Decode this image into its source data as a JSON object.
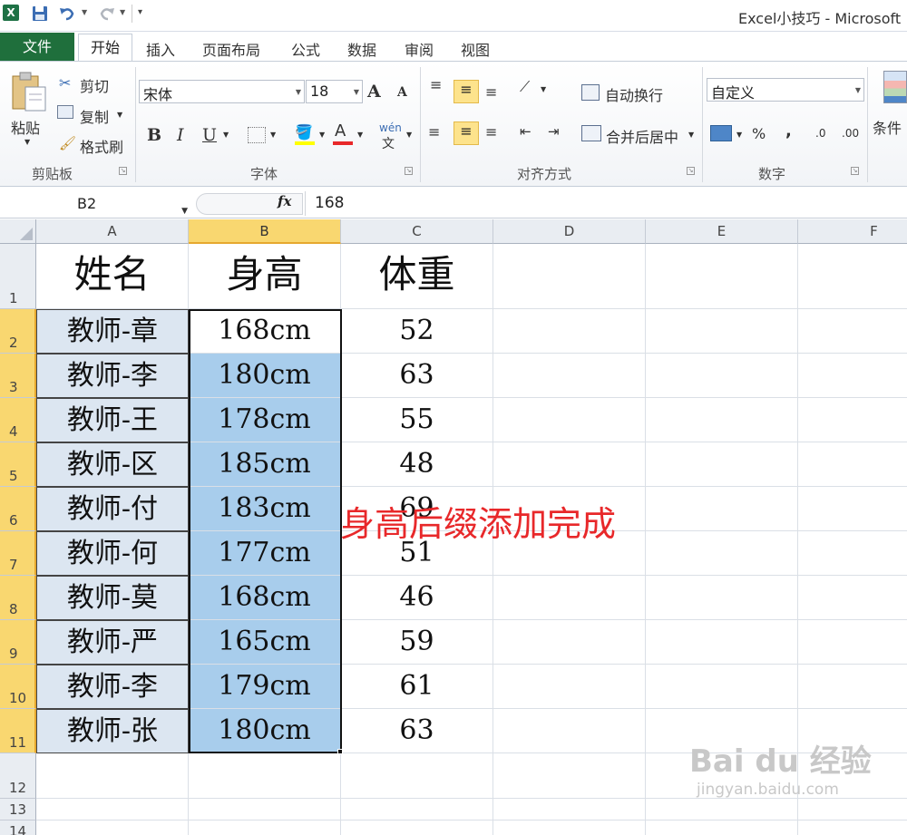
{
  "titlebar": {
    "logo": "X",
    "title": "Excel小技巧 - Microsoft"
  },
  "tabs": [
    "文件",
    "开始",
    "插入",
    "页面布局",
    "公式",
    "数据",
    "审阅",
    "视图"
  ],
  "ribbon": {
    "clipboard": {
      "paste": "粘贴",
      "cut": "剪切",
      "copy": "复制",
      "format_painter": "格式刷",
      "label": "剪贴板"
    },
    "font": {
      "name": "宋体",
      "size": "18",
      "bold": "B",
      "italic": "I",
      "underline": "U",
      "label": "字体",
      "grow": "A",
      "shrink": "A",
      "phonetic": "wén"
    },
    "alignment": {
      "wrap": "自动换行",
      "merge": "合并后居中",
      "label": "对齐方式"
    },
    "number": {
      "format": "自定义",
      "percent": "%",
      "comma": ",",
      "label": "数字"
    },
    "styles": {
      "conditional": "条件"
    }
  },
  "formula_bar": {
    "name_box": "B2",
    "fx": "fx",
    "value": "168"
  },
  "columns": [
    "A",
    "B",
    "C",
    "D",
    "E",
    "F"
  ],
  "rows": [
    "1",
    "2",
    "3",
    "4",
    "5",
    "6",
    "7",
    "8",
    "9",
    "10",
    "11",
    "12",
    "13",
    "14"
  ],
  "headers": {
    "name": "姓名",
    "height": "身高",
    "weight": "体重"
  },
  "data": [
    {
      "name": "教师-章",
      "height": "168cm",
      "weight": "52"
    },
    {
      "name": "教师-李",
      "height": "180cm",
      "weight": "63"
    },
    {
      "name": "教师-王",
      "height": "178cm",
      "weight": "55"
    },
    {
      "name": "教师-区",
      "height": "185cm",
      "weight": "48"
    },
    {
      "name": "教师-付",
      "height": "183cm",
      "weight": "69"
    },
    {
      "name": "教师-何",
      "height": "177cm",
      "weight": "51"
    },
    {
      "name": "教师-莫",
      "height": "168cm",
      "weight": "46"
    },
    {
      "name": "教师-严",
      "height": "165cm",
      "weight": "59"
    },
    {
      "name": "教师-李",
      "height": "179cm",
      "weight": "61"
    },
    {
      "name": "教师-张",
      "height": "180cm",
      "weight": "63"
    }
  ],
  "annotation": "身高后缀添加完成",
  "watermark": {
    "main": "Bai du 经验",
    "sub": "jingyan.baidu.com"
  },
  "colors": {
    "accent_green": "#1f6f3c",
    "selection": "#a8cdec",
    "header_highlight": "#f9d770",
    "annotation": "#e8282a"
  }
}
